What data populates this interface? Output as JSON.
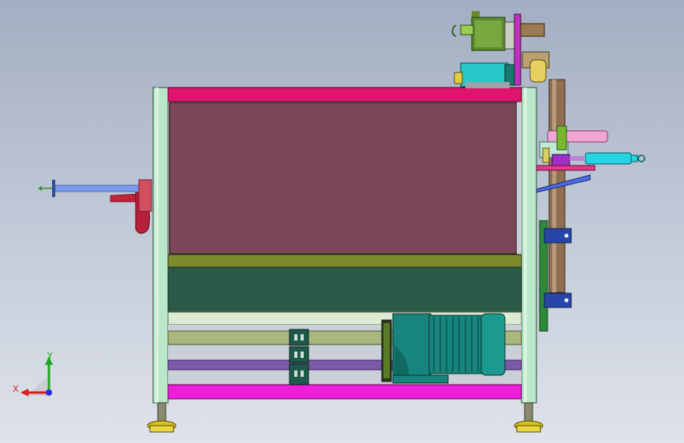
{
  "viewport": {
    "background_top": "#a3aec2",
    "background_bottom": "#dfe3ea"
  },
  "triad": {
    "x_label": "X",
    "y_label": "Y",
    "x_color": "#d81e1e",
    "y_color": "#1fa51f",
    "z_color": "#2a2ae0"
  },
  "model": {
    "frame_color": "#b8e8c8",
    "top_rail_color": "#e0146e",
    "bottom_rail_color": "#ec1ed8",
    "panel_color": "#7a4658",
    "olive_beam_color": "#7d8a2e",
    "dark_panel_color": "#2c5a48",
    "motor_color": "#17857d",
    "foot_color": "#d6c21a",
    "post_color": "#8f6e52",
    "cylinder_color": "#26d5e3",
    "pink_rod_color": "#f0a6d4",
    "blue_rod_color": "#7b9ae8"
  }
}
